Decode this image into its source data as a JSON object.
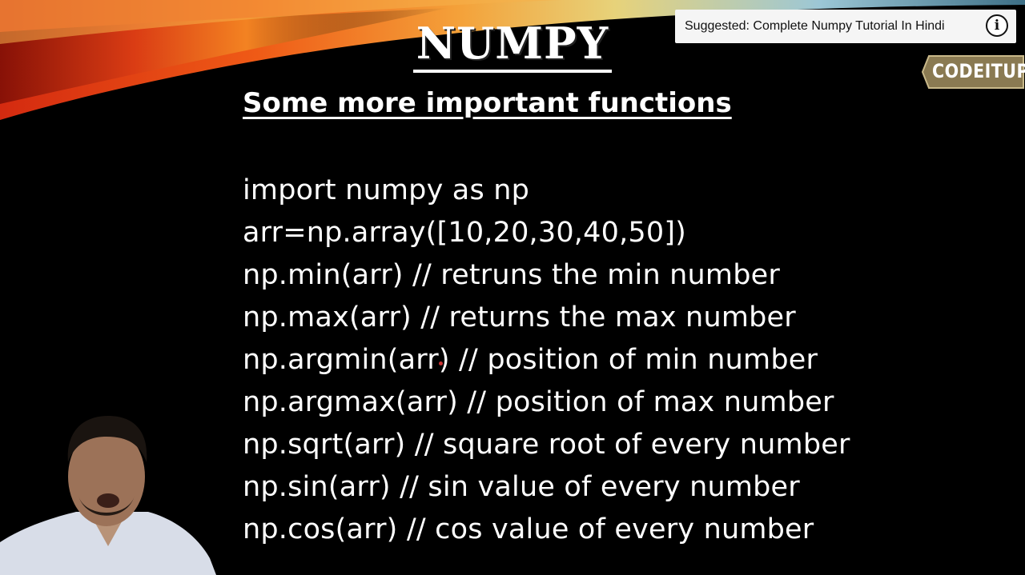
{
  "slide": {
    "title": "NUMPY",
    "subtitle": "Some more important functions",
    "code_lines": [
      "import numpy as np",
      "arr=np.array([10,20,30,40,50])",
      "np.min(arr) // retruns the min number",
      "np.max(arr) // returns the max number",
      "np.argmin(arr) // position of min number",
      "np.argmax(arr) // position of max number",
      "np.sqrt(arr) // square root of every number",
      "np.sin(arr) // sin value of every number",
      "np.cos(arr) // cos value of every number"
    ]
  },
  "overlay": {
    "suggested_text": "Suggested: Complete Numpy Tutorial In Hindi",
    "info_icon": "info-icon",
    "info_glyph": "i"
  },
  "branding": {
    "logo_text": "CODEITUP"
  },
  "colors": {
    "background": "#000000",
    "text": "#ffffff",
    "logo": "#8a7a52",
    "streak_red": "#e03a1a",
    "streak_orange": "#f07a20",
    "streak_yellow": "#e8d060"
  }
}
